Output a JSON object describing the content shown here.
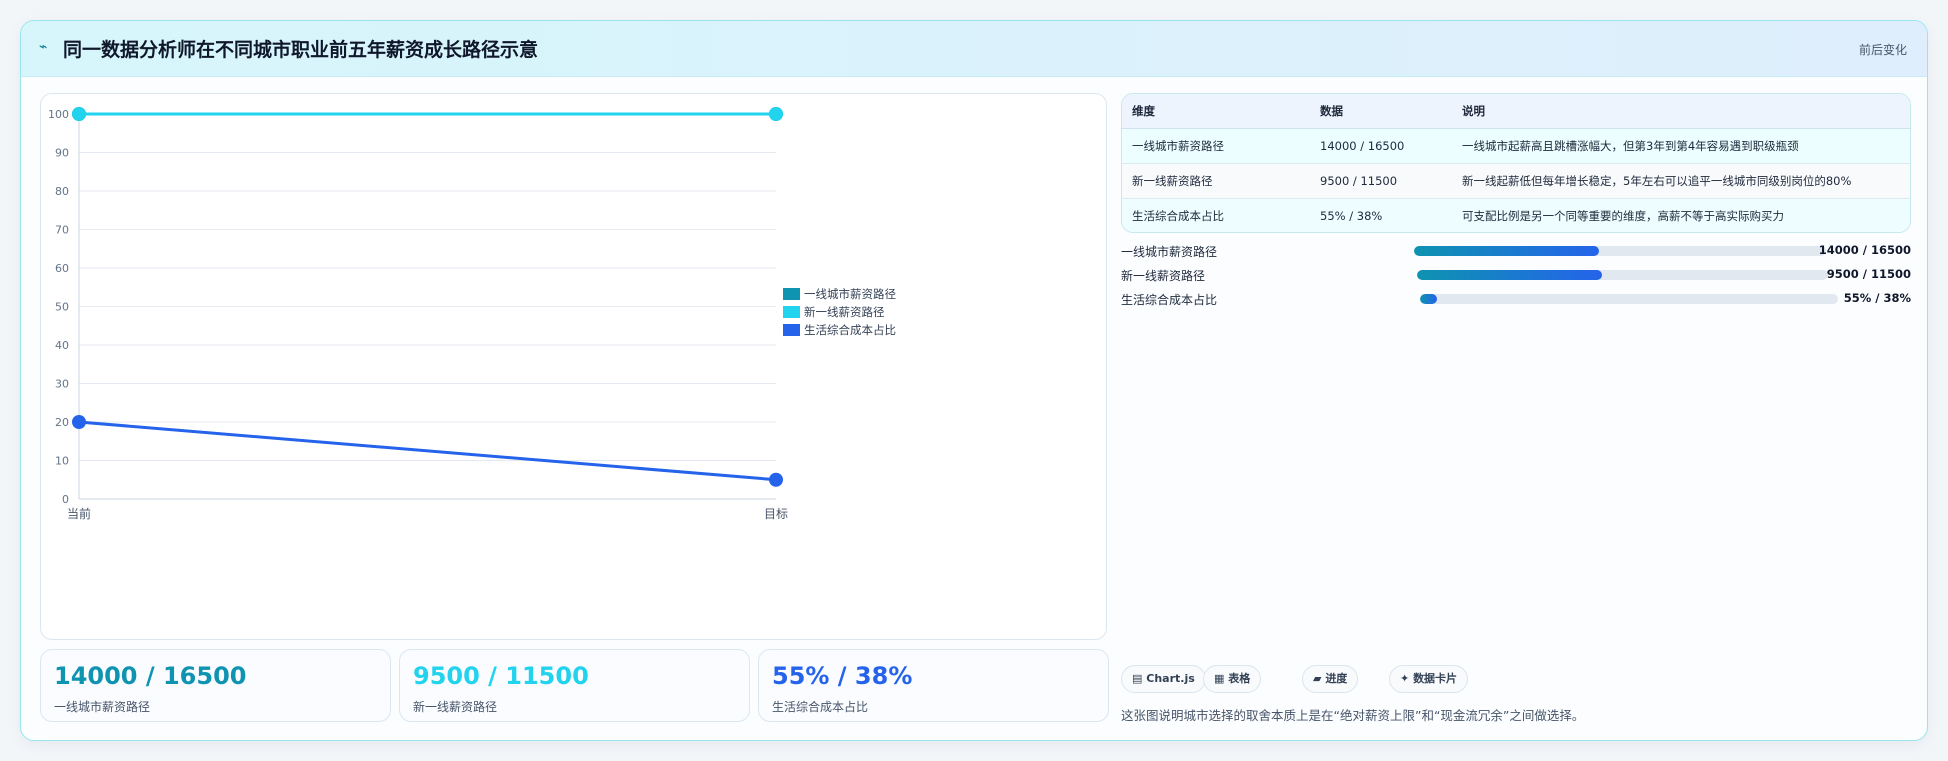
{
  "header": {
    "icon": "trend-icon",
    "title": "同一数据分析师在不同城市职业前五年薪资成长路径示意",
    "right_label": "前后变化"
  },
  "chart_data": {
    "type": "line",
    "categories": [
      "当前",
      "目标"
    ],
    "ylim": [
      0,
      100
    ],
    "yticks": [
      0,
      10,
      20,
      30,
      40,
      50,
      60,
      70,
      80,
      90,
      100
    ],
    "grid": true,
    "legend_position": "right",
    "series": [
      {
        "name": "一线城市薪资路径",
        "values": [
          100,
          100
        ],
        "color": "#0e93b0"
      },
      {
        "name": "新一线薪资路径",
        "values": [
          100,
          100
        ],
        "color": "#22d3ee"
      },
      {
        "name": "生活综合成本占比",
        "values": [
          20,
          5
        ],
        "color": "#2563eb"
      }
    ]
  },
  "stats": [
    {
      "value": "14000 / 16500",
      "label": "一线城市薪资路径",
      "color": "#0e93b0"
    },
    {
      "value": "9500 / 11500",
      "label": "新一线薪资路径",
      "color": "#22d3ee"
    },
    {
      "value": "55% / 38%",
      "label": "生活综合成本占比",
      "color": "#2563eb"
    }
  ],
  "table": {
    "headers": [
      "维度",
      "数据",
      "说明"
    ],
    "rows": [
      [
        "一线城市薪资路径",
        "14000 / 16500",
        "一线城市起薪高且跳槽涨幅大，但第3年到第4年容易遇到职级瓶颈"
      ],
      [
        "新一线薪资路径",
        "9500 / 11500",
        "新一线起薪低但每年增长稳定，5年左右可以追平一线城市同级别岗位的80%"
      ],
      [
        "生活综合成本占比",
        "55% / 38%",
        "可支配比例是另一个同等重要的维度，高薪不等于高实际购买力"
      ]
    ]
  },
  "progress": [
    {
      "label": "一线城市薪资路径",
      "value_text": "14000 / 16500",
      "fraction": 0.45
    },
    {
      "label": "新一线薪资路径",
      "value_text": "9500 / 11500",
      "fraction": 0.45
    },
    {
      "label": "生活综合成本占比",
      "value_text": "55% / 38%",
      "fraction": 0.04
    }
  ],
  "tags": [
    {
      "icon": "chart-icon",
      "glyph": "▤",
      "label": "Chart.js"
    },
    {
      "icon": "table-icon",
      "glyph": "▦",
      "label": "表格"
    },
    {
      "icon": "progress-icon",
      "glyph": "▰",
      "label": "进度"
    },
    {
      "icon": "card-icon",
      "glyph": "✦",
      "label": "数据卡片"
    }
  ],
  "note": "这张图说明城市选择的取舍本质上是在“绝对薪资上限”和“现金流冗余”之间做选择。"
}
